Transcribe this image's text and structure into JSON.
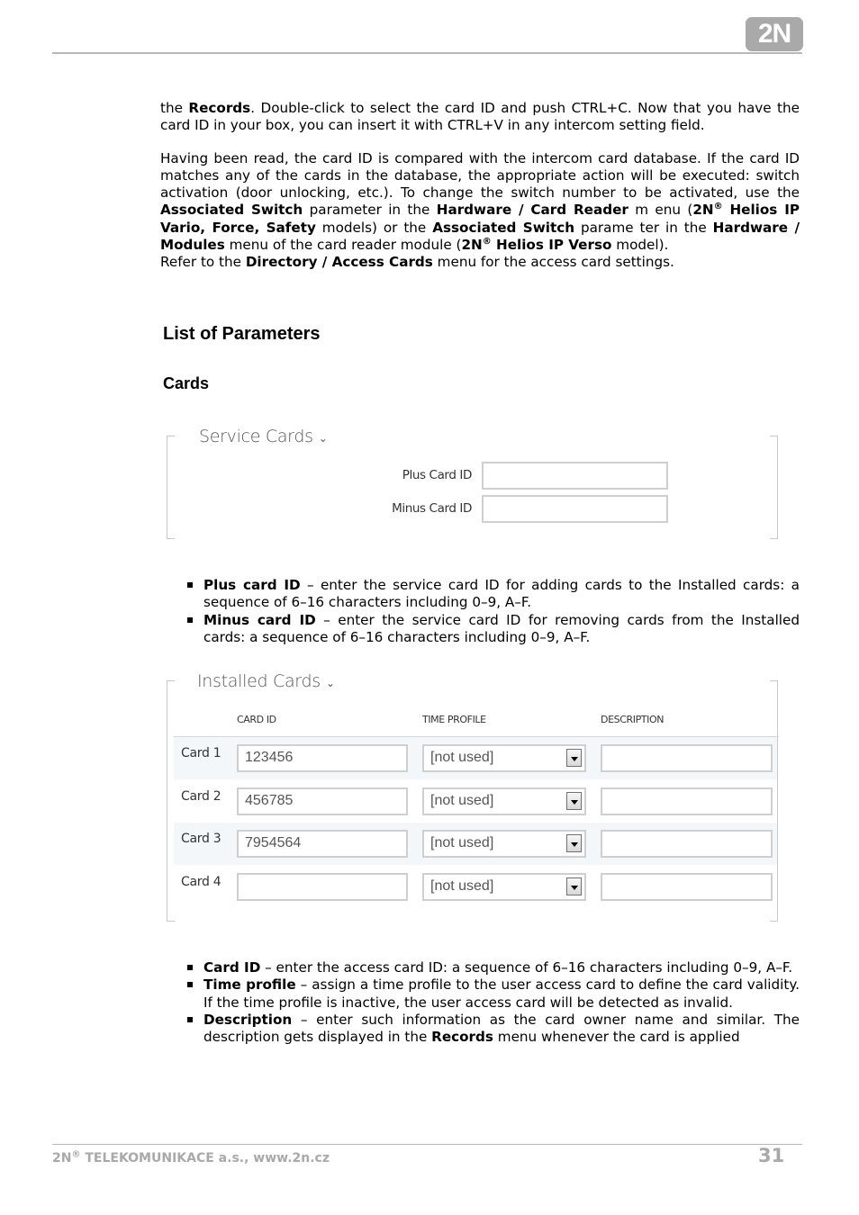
{
  "header": {
    "logo_text": "2N"
  },
  "intro": {
    "p1": [
      {
        "t": "the ",
        "b": false
      },
      {
        "t": "Records",
        "b": true
      },
      {
        "t": ". Double-click to select the card ID and push CTRL+C. Now that you have the card ID in your box, you can insert it with CTRL+V in any intercom setting field.",
        "b": false
      }
    ],
    "p2": [
      {
        "t": "Having been read, the card ID is compared with the intercom card database. If the card ID matches any of the cards in the database, the appropriate action will be executed: switch activation (door unlocking, etc.). To change the switch number to be activated, use the ",
        "b": false
      },
      {
        "t": "Associated Switch",
        "b": true
      },
      {
        "t": " parameter in the ",
        "b": false
      },
      {
        "t": "Hardware / Card Reader",
        "b": true
      },
      {
        "t": " m enu (",
        "b": false
      },
      {
        "t": "2N",
        "b": true,
        "sup": "®"
      },
      {
        "t": " Helios IP Vario, Force, Safety",
        "b": true
      },
      {
        "t": " models) or the ",
        "b": false
      },
      {
        "t": "Associated Switch",
        "b": true
      },
      {
        "t": " parame ter in the ",
        "b": false
      },
      {
        "t": "Hardware / Modules",
        "b": true
      },
      {
        "t": " menu of the card reader module (",
        "b": false
      },
      {
        "t": "2N",
        "b": true,
        "sup": "®"
      },
      {
        "t": " Helios IP Verso",
        "b": true
      },
      {
        "t": " model).",
        "b": false
      }
    ],
    "p3": [
      {
        "t": "Refer to the ",
        "b": false
      },
      {
        "t": "Directory / Access Cards",
        "b": true
      },
      {
        "t": " menu for the access card settings.",
        "b": false
      }
    ]
  },
  "headings": {
    "h1": "List of Parameters",
    "h2": "Cards"
  },
  "service_cards": {
    "title": "Service Cards",
    "chevron_icon": "chevron-down-icon",
    "fields": [
      {
        "label": "Plus Card ID",
        "value": ""
      },
      {
        "label": "Minus Card ID",
        "value": ""
      }
    ]
  },
  "service_bullets": [
    [
      {
        "t": "Plus card ID",
        "b": true
      },
      {
        "t": " – enter the service card ID for adding cards to the Installed cards: a sequence of 6–16 characters including 0–9, A–F.",
        "b": false
      }
    ],
    [
      {
        "t": "Minus card ID",
        "b": true
      },
      {
        "t": " –  enter the service card ID for removing cards from the Installed cards: a sequence of 6–16 characters including 0–9, A–F.",
        "b": false
      }
    ]
  ],
  "installed_cards": {
    "title": "Installed Cards",
    "chevron_icon": "chevron-down-icon",
    "columns": [
      "CARD ID",
      "TIME PROFILE",
      "DESCRIPTION"
    ],
    "rows": [
      {
        "label": "Card 1",
        "card_id": "123456",
        "time_profile": "[not used]",
        "description": ""
      },
      {
        "label": "Card 2",
        "card_id": "456785",
        "time_profile": "[not used]",
        "description": ""
      },
      {
        "label": "Card 3",
        "card_id": "7954564",
        "time_profile": "[not used]",
        "description": ""
      },
      {
        "label": "Card 4",
        "card_id": "",
        "time_profile": "[not used]",
        "description": ""
      }
    ]
  },
  "installed_bullets": [
    [
      {
        "t": "Card ID",
        "b": true
      },
      {
        "t": " – enter the access card ID: a sequence of 6–16 characters including 0–9, A–F.",
        "b": false
      }
    ],
    [
      {
        "t": "Time profile",
        "b": true
      },
      {
        "t": " – assign a time profile to the user access card to define the card validity. If the time profile is inactive, the user access card will be detected as invalid.",
        "b": false
      }
    ],
    [
      {
        "t": "Description",
        "b": true
      },
      {
        "t": " – enter such information as the card owner name and similar. The description gets displayed in the ",
        "b": false
      },
      {
        "t": "Records",
        "b": true
      },
      {
        "t": " menu whenever the card is applied",
        "b": false
      }
    ]
  ],
  "footer": {
    "company": "2N",
    "company_sup": "®",
    "company_rest": " TELEKOMUNIKACE a.s., www.2n.cz",
    "page_number": "31"
  }
}
